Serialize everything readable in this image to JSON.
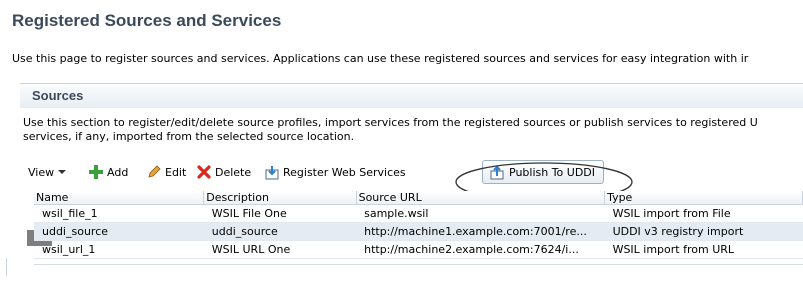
{
  "page": {
    "title": "Registered Sources and Services",
    "description": "Use this page to register sources and services. Applications can use these registered sources and services for easy integration with ir"
  },
  "section": {
    "title": "Sources",
    "desc_line1": "Use this section to register/edit/delete source profiles, import services from the registered sources or publish services to registered U",
    "desc_line2": "services, if any, imported from the selected source location."
  },
  "toolbar": {
    "view_label": "View",
    "add_label": "Add",
    "edit_label": "Edit",
    "delete_label": "Delete",
    "register_label": "Register Web Services",
    "publish_label": "Publish To UDDI"
  },
  "table": {
    "headers": [
      "Name",
      "Description",
      "Source URL",
      "Type"
    ],
    "rows": [
      {
        "name": "wsil_file_1",
        "description": "WSIL File One",
        "url": "sample.wsil",
        "type": "WSIL import from File",
        "selected": false
      },
      {
        "name": "uddi_source",
        "description": "uddi_source",
        "url": "http://machine1.example.com:7001/re...",
        "type": "UDDI v3 registry import",
        "selected": true
      },
      {
        "name": "wsil_url_1",
        "description": "WSIL URL One",
        "url": "http://machine2.example.com:7624/i...",
        "type": "WSIL import from URL",
        "selected": false
      }
    ]
  },
  "colors": {
    "heading": "#3a4a5b",
    "selected_row": "#e4ebf2",
    "selected_marker": "#7e7e7e",
    "add_icon": "#3aa23a",
    "delete_icon": "#d9281c",
    "publish_icon": "#2f7fd0"
  },
  "icons": {
    "view": "chevron-down-icon",
    "add": "plus-icon",
    "edit": "pencil-icon",
    "delete": "x-icon",
    "register": "register-icon",
    "publish": "upload-icon"
  }
}
